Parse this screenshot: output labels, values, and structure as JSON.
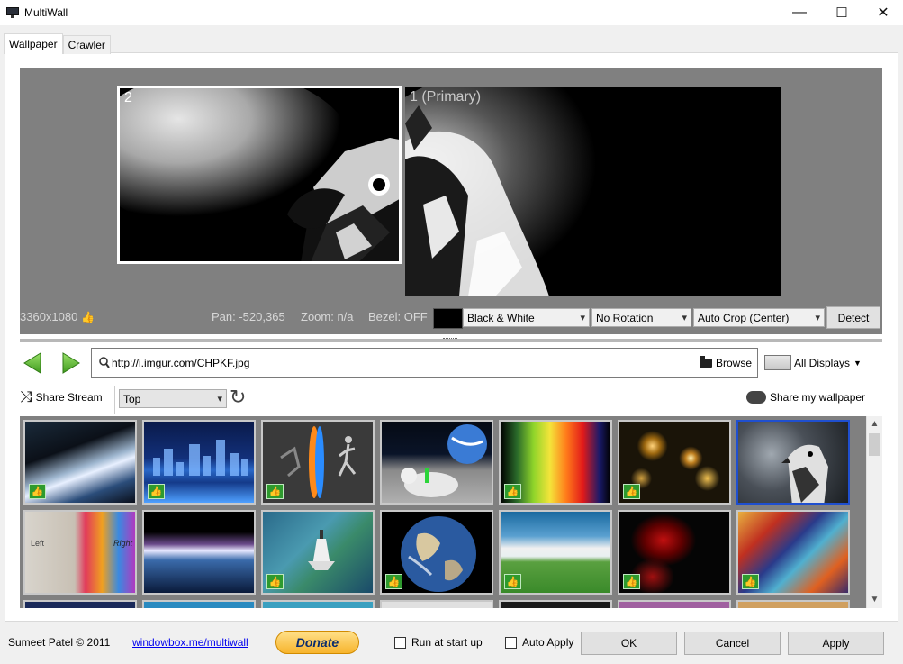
{
  "window": {
    "title": "MultiWall",
    "minimize": "—",
    "maximize": "☐",
    "close": "✕"
  },
  "tabs": [
    {
      "label": "Wallpaper",
      "active": true
    },
    {
      "label": "Crawler",
      "active": false
    }
  ],
  "preview": {
    "monitors": [
      {
        "label": "2"
      },
      {
        "label": "1 (Primary)"
      }
    ],
    "resolution": "3360x1080",
    "pan": "Pan: -520,365",
    "zoom": "Zoom: n/a",
    "bezel": "Bezel: OFF",
    "color_mode": "Black & White",
    "rotation": "No Rotation",
    "crop": "Auto Crop (Center)",
    "detect_label": "Detect"
  },
  "nav": {
    "back_icon": "green-left-arrow",
    "forward_icon": "green-right-arrow"
  },
  "url": {
    "value": "http://i.imgur.com/CHPKF.jpg",
    "browse_label": "Browse"
  },
  "displays_label": "All Displays",
  "stream": {
    "share_label": "Share Stream",
    "sort_value": "Top",
    "share_wallpaper_label": "Share my wallpaper"
  },
  "footer": {
    "author": "Sumeet Patel © 2011",
    "link": "windowbox.me/multiwall",
    "donate_label": "Donate",
    "run_at_startup": "Run at start up",
    "auto_apply": "Auto Apply",
    "ok_label": "OK",
    "cancel_label": "Cancel",
    "apply_label": "Apply"
  },
  "colors": {
    "accent": "#1f4fcf",
    "like_badge": "#2e9a2e",
    "preview_bg": "#808080"
  },
  "thumbnails": [
    {
      "subject": "earth-horizon",
      "liked": true,
      "selected": false
    },
    {
      "subject": "city-skyline-blue",
      "liked": true,
      "selected": false
    },
    {
      "subject": "portal",
      "liked": true,
      "selected": false
    },
    {
      "subject": "astronaut-on-moon",
      "liked": true,
      "selected": false
    },
    {
      "subject": "spectrum-bars",
      "liked": true,
      "selected": false
    },
    {
      "subject": "bokeh-lights",
      "liked": true,
      "selected": false
    },
    {
      "subject": "hawk",
      "liked": false,
      "selected": true
    },
    {
      "subject": "left-right-brain",
      "liked": false,
      "selected": false
    },
    {
      "subject": "planet-sunrise",
      "liked": false,
      "selected": false
    },
    {
      "subject": "space-shuttle",
      "liked": true,
      "selected": false
    },
    {
      "subject": "earth-globe",
      "liked": true,
      "selected": false
    },
    {
      "subject": "green-field-clouds",
      "liked": true,
      "selected": false
    },
    {
      "subject": "red-splash",
      "liked": true,
      "selected": false
    },
    {
      "subject": "comic-heroes",
      "liked": true,
      "selected": false
    }
  ]
}
